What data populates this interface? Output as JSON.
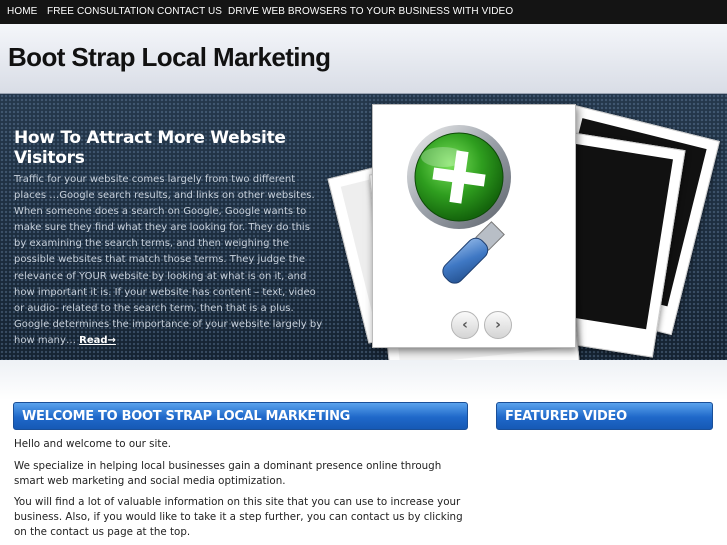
{
  "nav": {
    "items": [
      {
        "label": "HOME"
      },
      {
        "label": "FREE CONSULTATION"
      },
      {
        "label": "CONTACT US"
      },
      {
        "label": "DRIVE WEB BROWSERS TO YOUR BUSINESS WITH VIDEO"
      }
    ]
  },
  "header": {
    "title": "Boot Strap Local Marketing"
  },
  "hero": {
    "title": "How To Attract More Website Visitors",
    "text": "Traffic for your website comes largely from two different places …Google search results, and links on other websites. When someone does a search on Google, Google wants to make sure they find what they are looking for. They do this by examining the search terms, and then weighing the possible websites that match those terms. They judge the relevance of YOUR website by looking at what is on it, and how important it is. If your website has content – text, video or audio- related to the search term, then that is a plus. Google determines the importance of your website largely by how many…",
    "read_more": "Read→",
    "prev_icon": "chevron-left-icon",
    "next_icon": "chevron-right-icon",
    "prev_glyph": "‹",
    "next_glyph": "›",
    "image_icon": "magnifying-glass-plus-icon"
  },
  "main": {
    "welcome_heading": "WELCOME TO BOOT STRAP LOCAL MARKETING",
    "paragraphs": [
      "Hello and welcome to our site.",
      "We specialize in helping local businesses gain a dominant presence online through smart web marketing and social media optimization.",
      "You will find a lot of valuable information on this site that you can use to increase your business. Also, if you would like to take it a step further, you can contact us by clicking on the contact us page at the top."
    ]
  },
  "sidebar": {
    "featured_heading": "FEATURED VIDEO"
  },
  "colors": {
    "nav_bg": "#141414",
    "accent_blue": "#1f68c9",
    "hero_bg": "#1c2c3d",
    "magnifier_green": "#2f9e1f"
  }
}
